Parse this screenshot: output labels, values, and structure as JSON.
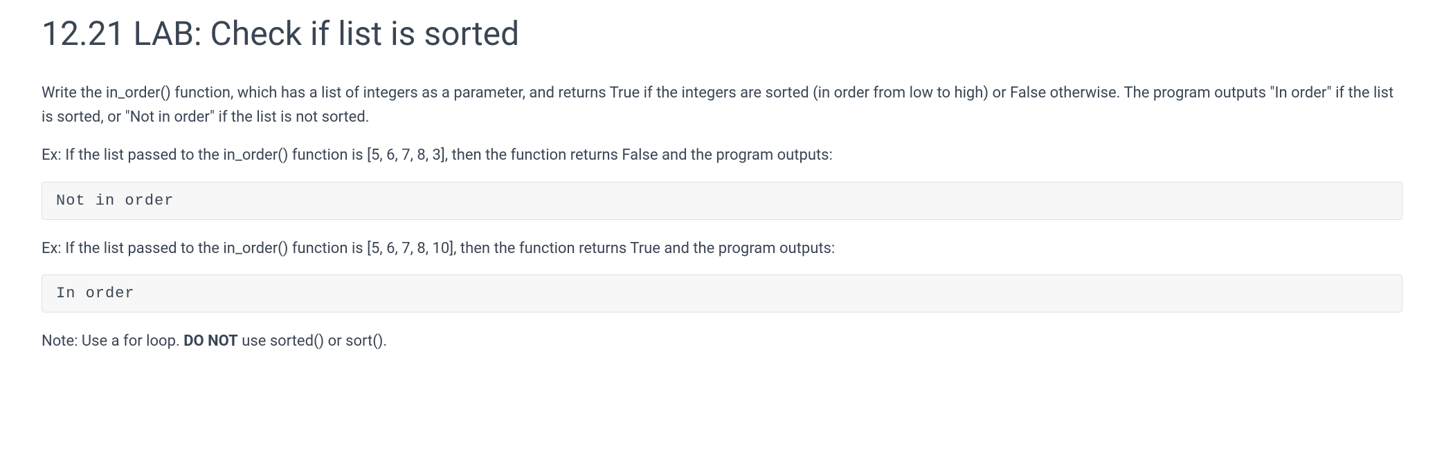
{
  "title": "12.21 LAB: Check if list is sorted",
  "paragraphs": {
    "intro": "Write the in_order() function, which has a list of integers as a parameter, and returns True if the integers are sorted (in order from low to high) or False otherwise. The program outputs \"In order\" if the list is sorted, or \"Not in order\" if the list is not sorted.",
    "example1": "Ex: If the list passed to the in_order() function is [5, 6, 7, 8, 3], then the function returns False and the program outputs:",
    "example2": "Ex: If the list passed to the in_order() function is [5, 6, 7, 8, 10], then the function returns True and the program outputs:",
    "note_prefix": "Note: Use a for loop. ",
    "note_bold": "DO NOT",
    "note_suffix": " use sorted() or sort()."
  },
  "code_blocks": {
    "output1": "Not in order",
    "output2": "In order"
  }
}
